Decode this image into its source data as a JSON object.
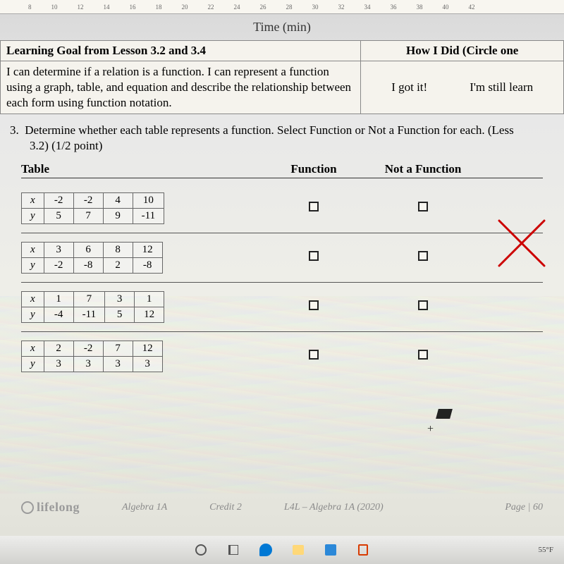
{
  "ruler_ticks": [
    "8",
    "10",
    "12",
    "14",
    "16",
    "18",
    "20",
    "22",
    "24",
    "26",
    "28",
    "30",
    "32",
    "34",
    "36",
    "38",
    "40",
    "42"
  ],
  "axis_label": "Time (min)",
  "goal": {
    "header_left": "Learning Goal from Lesson 3.2 and 3.4",
    "header_right": "How I Did (Circle one",
    "body_left": "I can determine if a relation is a function. I can represent a function using a graph, table, and equation and describe the relationship between each form using function notation.",
    "option_a": "I got it!",
    "option_b": "I'm still learn"
  },
  "question": {
    "number": "3.",
    "text": "Determine whether each table represents a function. Select Function or Not a Function for each. (Less",
    "sub": "3.2) (1/2 point)"
  },
  "headers": {
    "table": "Table",
    "func": "Function",
    "notfunc": "Not a Function"
  },
  "labels": {
    "x": "x",
    "y": "y"
  },
  "tables": [
    {
      "x": [
        "-2",
        "-2",
        "4",
        "10"
      ],
      "y": [
        "5",
        "7",
        "9",
        "-11"
      ]
    },
    {
      "x": [
        "3",
        "6",
        "8",
        "12"
      ],
      "y": [
        "-2",
        "-8",
        "2",
        "-8"
      ]
    },
    {
      "x": [
        "1",
        "7",
        "3",
        "1"
      ],
      "y": [
        "-4",
        "-11",
        "5",
        "12"
      ]
    },
    {
      "x": [
        "2",
        "-2",
        "7",
        "12"
      ],
      "y": [
        "3",
        "3",
        "3",
        "3"
      ]
    }
  ],
  "footer": {
    "brand": "lifelong",
    "course": "Algebra 1A",
    "credit": "Credit 2",
    "code": "L4L – Algebra 1A (2020)",
    "page": "Page | 60"
  },
  "systray": "55°F"
}
